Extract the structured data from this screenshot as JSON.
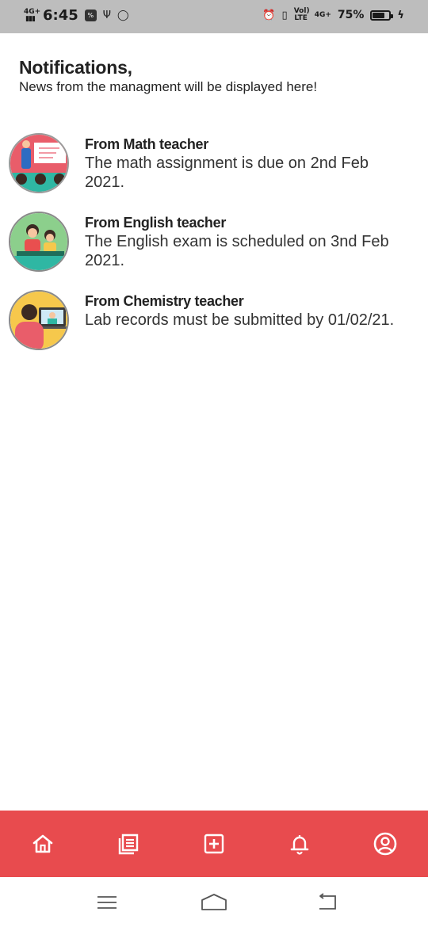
{
  "status_bar": {
    "network_left": "4G+",
    "time": "6:45",
    "right_labels": {
      "volte": "Vol) LTE",
      "network": "4G+"
    },
    "battery_text": "75%",
    "battery_level": 0.75
  },
  "header": {
    "title": "Notifications,",
    "subtitle": "News from the managment will be displayed here!"
  },
  "notifications": [
    {
      "title": "From Math teacher",
      "body": "The math assignment is due on 2nd Feb 2021.",
      "avatar_icon": "teacher-at-board-icon",
      "avatar_bg": "#e95d6a"
    },
    {
      "title": "From English teacher",
      "body": "The English exam is scheduled on 3nd Feb 2021.",
      "avatar_icon": "students-at-desk-icon",
      "avatar_bg": "#8ccf8c"
    },
    {
      "title": "From Chemistry teacher",
      "body": "Lab records must be submitted by 01/02/21.",
      "avatar_icon": "online-class-icon",
      "avatar_bg": "#f6c84c"
    }
  ],
  "bottom_nav": {
    "background": "#e84b4e",
    "items": [
      "home-icon",
      "news-icon",
      "add-icon",
      "bell-icon",
      "profile-icon"
    ]
  },
  "system_nav": {
    "items": [
      "recent-apps-icon",
      "home-icon",
      "back-icon"
    ]
  }
}
